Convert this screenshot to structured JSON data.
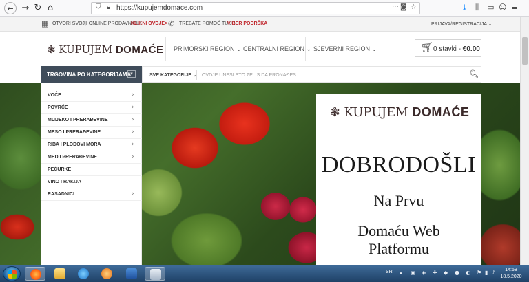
{
  "browser": {
    "url": "https://kupujemdomace.com"
  },
  "topbar": {
    "sell_text": "OTVORI SVOJ|I ONLINE PRODAVNICU!",
    "sell_link": "KLIKNI OVDJE>",
    "help_text": "TREBATE POMOĆ TU JE",
    "help_link": "VIBER PODRŠKA",
    "account": "PRIJAVA/REGISTRACIJA"
  },
  "header": {
    "logo_light": "KUPUJEM",
    "logo_bold": "DOMAĆE",
    "menu": [
      {
        "label": "PRIMORSKI REGION"
      },
      {
        "label": "CENTRALNI REGION"
      },
      {
        "label": "SJEVERNI REGION"
      }
    ],
    "cart_count": "0 stavki -",
    "cart_total": "€0.00"
  },
  "category_bar": {
    "title": "TRGOVINA PO KATEGORIJAMA",
    "search_category": "SVE KATEGORIJE",
    "search_placeholder": "OVDJE UNESI ŠTO ŽELIŠ DA PRONAĐEŠ ..."
  },
  "sidebar": {
    "items": [
      {
        "label": "VOĆE",
        "has_sub": true
      },
      {
        "label": "POVRĆE",
        "has_sub": true
      },
      {
        "label": "MLIJEKO I PRERAĐEVINE",
        "has_sub": true
      },
      {
        "label": "MESO I PRERAĐEVINE",
        "has_sub": true
      },
      {
        "label": "RIBA I PLODOVI MORA",
        "has_sub": true
      },
      {
        "label": "MED I PRERAĐEVINE",
        "has_sub": true
      },
      {
        "label": "PEČURKE",
        "has_sub": false
      },
      {
        "label": "VINO I RAKIJA",
        "has_sub": false
      },
      {
        "label": "RASADNICI",
        "has_sub": true
      }
    ]
  },
  "hero": {
    "logo_light": "KUPUJEM",
    "logo_bold": "DOMAĆE",
    "welcome": "DOBRODOŠLI",
    "line1": "Na Prvu",
    "line2a": "Domaću Web",
    "line2b": "Platformu"
  },
  "taskbar": {
    "language": "SR",
    "time": "14:58",
    "date": "18.5.2020"
  }
}
